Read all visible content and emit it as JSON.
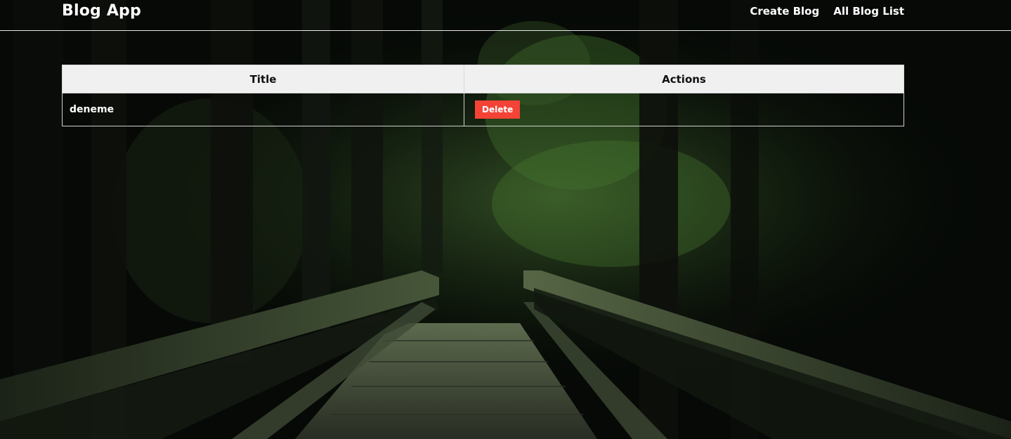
{
  "navbar": {
    "brand": "Blog App",
    "links": [
      {
        "label": "Create Blog"
      },
      {
        "label": "All Blog List"
      }
    ]
  },
  "table": {
    "headers": {
      "title": "Title",
      "actions": "Actions"
    },
    "rows": [
      {
        "title": "deneme",
        "action_label": "Delete"
      }
    ]
  },
  "colors": {
    "delete_button": "#f44336",
    "header_background": "#f0f0f0",
    "text": "#ffffff"
  }
}
